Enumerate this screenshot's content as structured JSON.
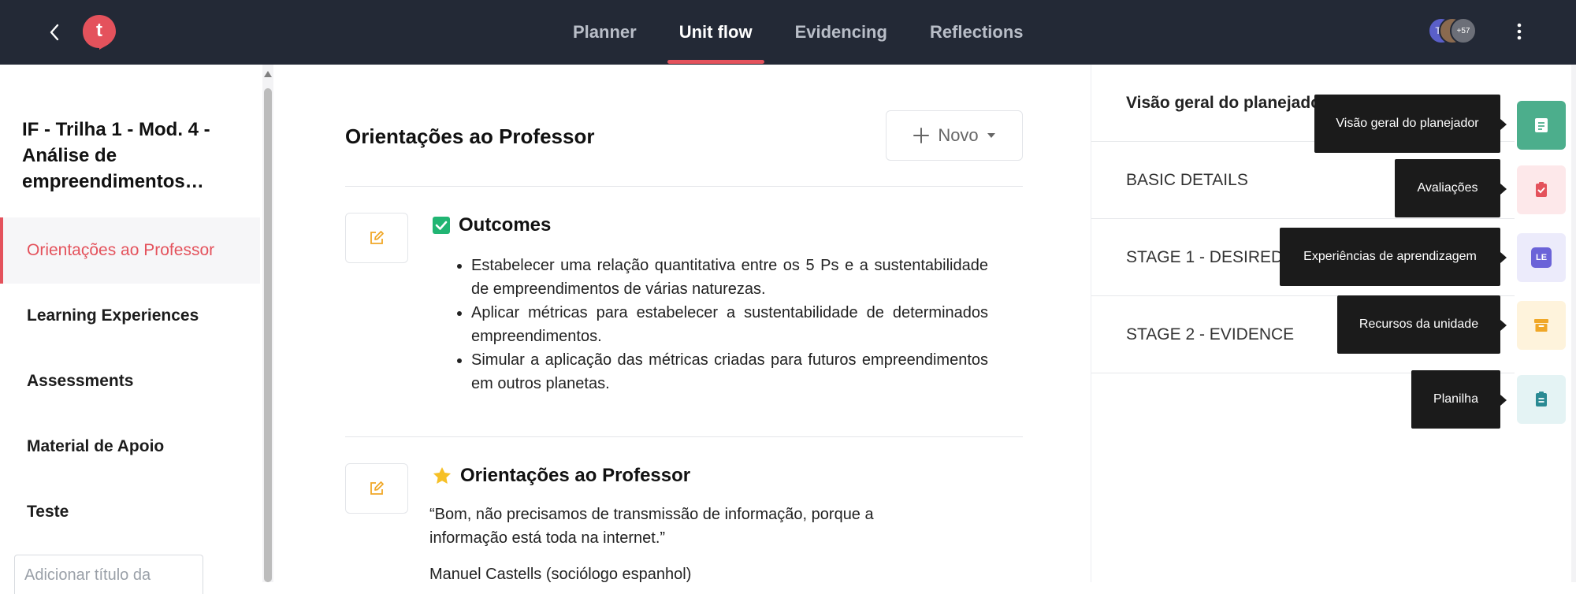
{
  "topbar": {
    "tabs": [
      {
        "label": "Planner",
        "active": false
      },
      {
        "label": "Unit flow",
        "active": true
      },
      {
        "label": "Evidencing",
        "active": false
      },
      {
        "label": "Reflections",
        "active": false
      }
    ],
    "logo_letter": "t",
    "avatar_initials": "TS",
    "avatar_more": "+57",
    "accent": "#e4525c",
    "bg": "#232936"
  },
  "sidebar": {
    "unit_title": "IF - Trilha 1 - Mod. 4 - Análise de empreendimentos…",
    "items": [
      {
        "label": "Orientações ao Professor",
        "active": true
      },
      {
        "label": "Learning Experiences",
        "active": false
      },
      {
        "label": "Assessments",
        "active": false
      },
      {
        "label": "Material de Apoio",
        "active": false
      },
      {
        "label": "Teste",
        "active": false
      }
    ],
    "add_title_placeholder": "Adicionar título da"
  },
  "main": {
    "section_title": "Orientações ao Professor",
    "novo_label": "Novo",
    "outcomes": {
      "title": "Outcomes",
      "items": [
        "Estabelecer uma relação quantitativa entre os 5 Ps e a sustentabilidade de empreendimentos de várias naturezas.",
        "Aplicar métricas para estabelecer a sustentabilidade de determinados empreendimentos.",
        "Simular a aplicação das métricas criadas para futuros empreendimentos em outros planetas."
      ]
    },
    "guidance": {
      "title": "Orientações ao Professor",
      "quote": "“Bom, não precisamos de transmissão de informação, porque a informação está toda na internet.”",
      "author": "Manuel Castells (sociólogo espanhol)"
    }
  },
  "right_panel": {
    "items": [
      {
        "label": "Visão geral do planejador"
      },
      {
        "label": "BASIC DETAILS"
      },
      {
        "label": "STAGE 1 - DESIRED RESULTS"
      },
      {
        "label": "STAGE 2 - EVIDENCE"
      }
    ]
  },
  "tooltips": [
    "Visão geral do planejador",
    "Avaliações",
    "Experiências de aprendizagem",
    "Recursos da unidade",
    "Planilha"
  ],
  "rail": {
    "le_label": "LE",
    "colors": {
      "overview": "#4cae8c",
      "assessments_bg": "#fde8ea",
      "assessments_fg": "#e4525c",
      "le_bg": "#ecebfb",
      "le_fg": "#6b63d8",
      "resources_bg": "#fef3dc",
      "resources_fg": "#f0a727",
      "sheet_bg": "#e4f3f4",
      "sheet_fg": "#2a8a93"
    }
  }
}
